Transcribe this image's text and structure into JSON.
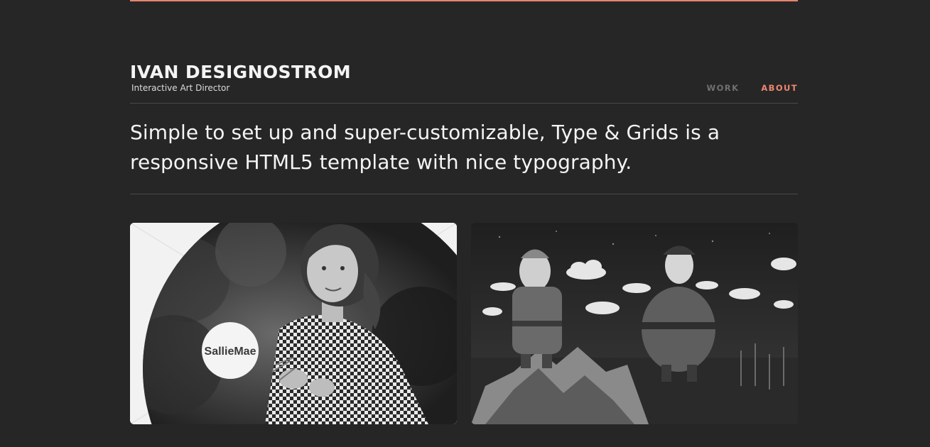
{
  "header": {
    "title": "IVAN DESIGNOSTROM",
    "subtitle": "Interactive Art Director"
  },
  "nav": {
    "items": [
      {
        "label": "WORK",
        "active": false
      },
      {
        "label": "ABOUT",
        "active": true
      }
    ]
  },
  "intro": {
    "text": "Simple to set up and super-customizable, Type & Grids is a responsive HTML5 template with nice typography."
  },
  "portfolio": {
    "items": [
      {
        "logo_text": "SallieMae"
      },
      {
        "logo_text": ""
      }
    ]
  },
  "colors": {
    "background": "#262626",
    "accent": "#e8846d",
    "nav_inactive": "#707070",
    "divider": "#484848"
  }
}
